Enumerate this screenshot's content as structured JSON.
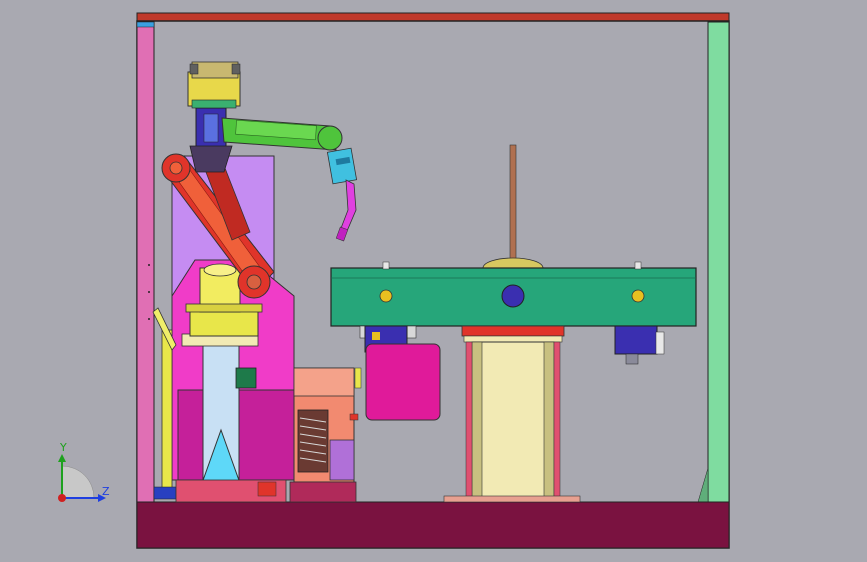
{
  "viewport": {
    "background_color": "#a9a9b1",
    "model_description_hidden": ""
  },
  "triad": {
    "y_label": "Y",
    "z_label": "Z",
    "y_color": "#1ea11e",
    "z_color": "#1f3fe0",
    "x_color": "#d02020"
  },
  "colors": {
    "frame_top": "#c0392b",
    "frame_left": "#e06fb4",
    "frame_right": "#7fdca0",
    "floor": "#7a1240",
    "table_green": "#26a67a",
    "robot_arm_green": "#4fc43c",
    "robot_link_red": "#e0342a",
    "robot_base_yellow": "#e8e64a",
    "enclosure_pink": "#f03cc8",
    "lilac_panel": "#c58cf2",
    "pedestal_cream": "#f2eab4",
    "magenta_box": "#e01a9a",
    "torch_magenta": "#e040e0",
    "motor_blue": "#3a2fb0"
  }
}
